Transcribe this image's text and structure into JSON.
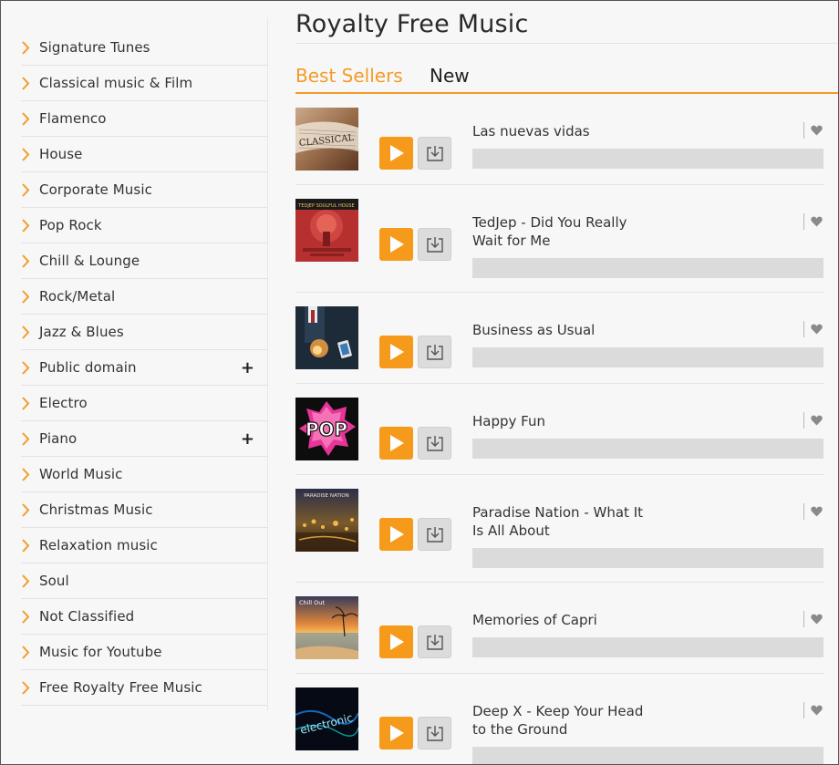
{
  "page": {
    "title": "Royalty Free Music"
  },
  "tabs": [
    {
      "label": "Best Sellers",
      "active": true
    },
    {
      "label": "New",
      "active": false
    }
  ],
  "sidebar": {
    "items": [
      {
        "label": "Signature Tunes",
        "expandable": false
      },
      {
        "label": "Classical music & Film",
        "expandable": false
      },
      {
        "label": "Flamenco",
        "expandable": false
      },
      {
        "label": "House",
        "expandable": false
      },
      {
        "label": "Corporate Music",
        "expandable": false
      },
      {
        "label": "Pop Rock",
        "expandable": false
      },
      {
        "label": "Chill & Lounge",
        "expandable": false
      },
      {
        "label": "Rock/Metal",
        "expandable": false
      },
      {
        "label": "Jazz & Blues",
        "expandable": false
      },
      {
        "label": "Public domain",
        "expandable": true
      },
      {
        "label": "Electro",
        "expandable": false
      },
      {
        "label": "Piano",
        "expandable": true
      },
      {
        "label": "World Music",
        "expandable": false
      },
      {
        "label": "Christmas Music",
        "expandable": false
      },
      {
        "label": "Relaxation music",
        "expandable": false
      },
      {
        "label": "Soul",
        "expandable": false
      },
      {
        "label": "Not Classified",
        "expandable": false
      },
      {
        "label": "Music for Youtube",
        "expandable": false
      },
      {
        "label": "Free Royalty Free Music",
        "expandable": false
      }
    ],
    "expand_symbol": "+"
  },
  "tracks": [
    {
      "title": "Las nuevas vidas",
      "cover_text": "CLASSICAL"
    },
    {
      "title": "TedJep - Did You Really Wait for Me",
      "cover_text": "TEDJEP SOULFUL HOUSE"
    },
    {
      "title": "Business as Usual",
      "cover_text": ""
    },
    {
      "title": "Happy Fun",
      "cover_text": "POP"
    },
    {
      "title": "Paradise Nation - What It Is All About",
      "cover_text": "PARADISE NATION"
    },
    {
      "title": "Memories of Capri",
      "cover_text": "Chill  Out"
    },
    {
      "title": "Deep X - Keep Your Head to the Ground",
      "cover_text": "electronic"
    }
  ],
  "icons": {
    "category": "chevron-right-icon",
    "play": "play-icon",
    "download": "download-icon",
    "favorite": "heart-icon"
  },
  "colors": {
    "accent": "#f39c28",
    "play_button": "#f59a1b",
    "download_button": "#dcdcdc",
    "waveform": "#dbdbdb"
  }
}
